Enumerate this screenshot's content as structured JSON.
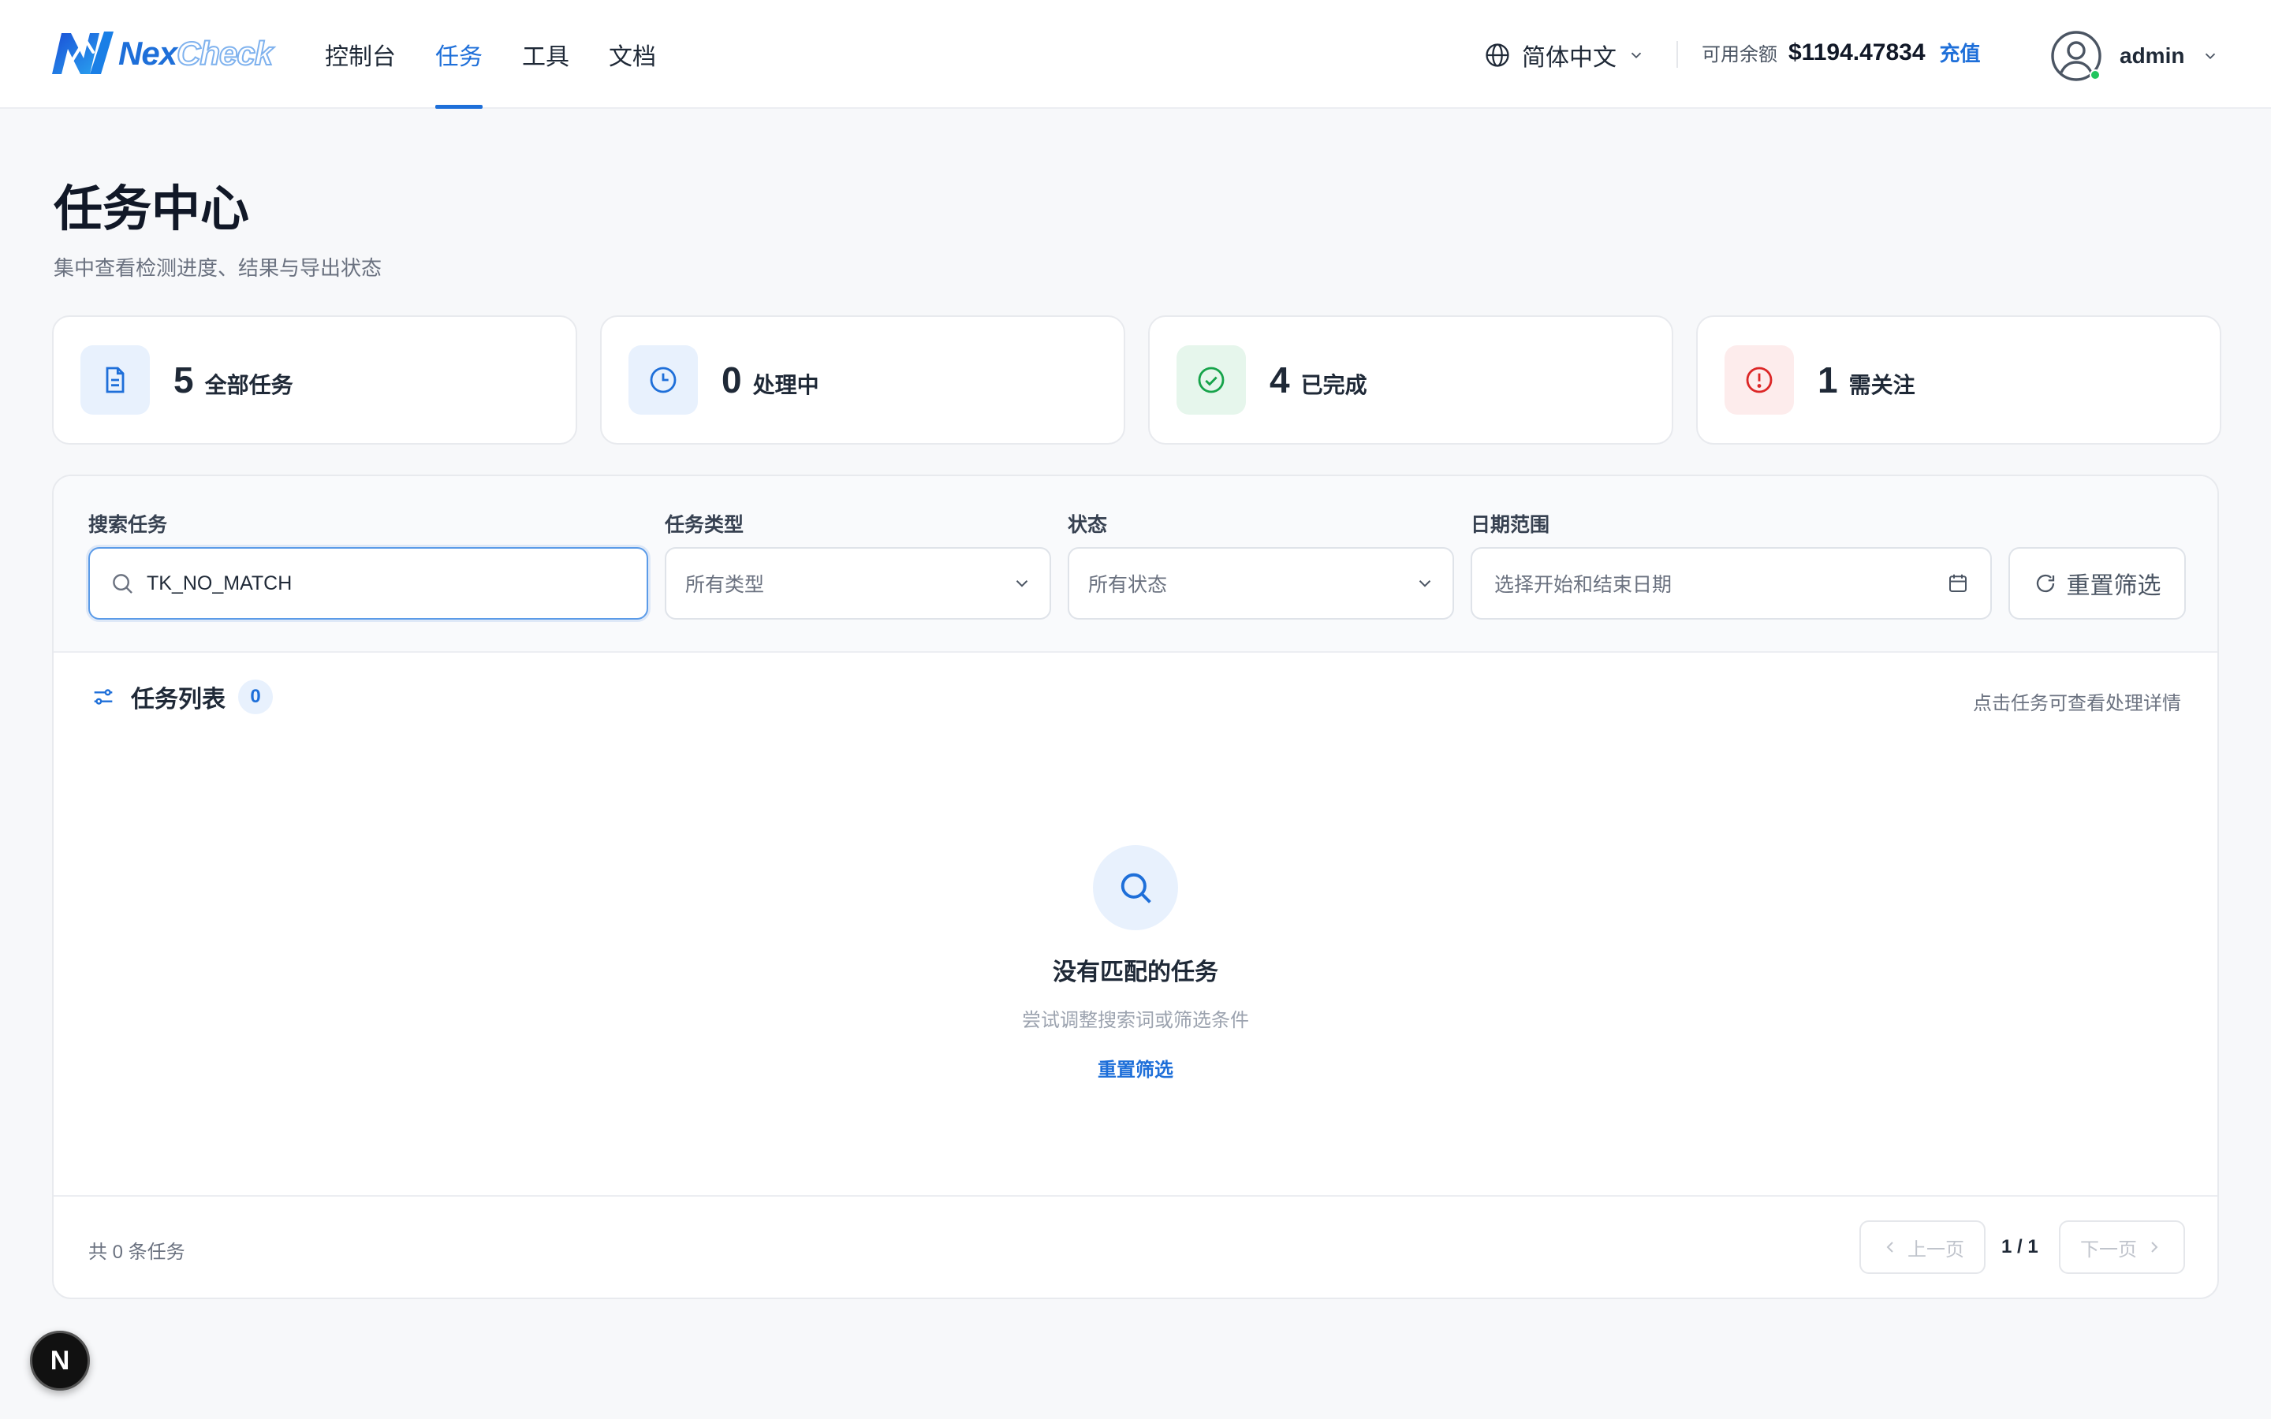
{
  "brand": {
    "name_part1": "Nex",
    "name_part2": "Check"
  },
  "nav": {
    "items": [
      "控制台",
      "任务",
      "工具",
      "文档"
    ],
    "active": "任务"
  },
  "header": {
    "language": "简体中文",
    "balance_label": "可用余额",
    "balance_value": "$1194.47834",
    "recharge": "充值",
    "username": "admin"
  },
  "page": {
    "title": "任务中心",
    "subtitle": "集中查看检测进度、结果与导出状态"
  },
  "stats": [
    {
      "value": "5",
      "label": "全部任务",
      "icon": "document-icon",
      "color": "#1e6fd9"
    },
    {
      "value": "0",
      "label": "处理中",
      "icon": "clock-icon",
      "color": "#1e6fd9"
    },
    {
      "value": "4",
      "label": "已完成",
      "icon": "check-circle-icon",
      "color": "#16a34a"
    },
    {
      "value": "1",
      "label": "需关注",
      "icon": "alert-circle-icon",
      "color": "#dc2626"
    }
  ],
  "filters": {
    "search_label": "搜索任务",
    "search_value": "TK_NO_MATCH",
    "type_label": "任务类型",
    "type_value": "所有类型",
    "status_label": "状态",
    "status_value": "所有状态",
    "date_label": "日期范围",
    "date_placeholder": "选择开始和结束日期",
    "reset": "重置筛选"
  },
  "list": {
    "title": "任务列表",
    "count": "0",
    "hint": "点击任务可查看处理详情",
    "empty_title": "没有匹配的任务",
    "empty_sub": "尝试调整搜索词或筛选条件",
    "empty_action": "重置筛选"
  },
  "footer": {
    "total": "共 0 条任务",
    "prev": "上一页",
    "page_info": "1 / 1",
    "next": "下一页"
  },
  "fab": {
    "label": "N"
  }
}
